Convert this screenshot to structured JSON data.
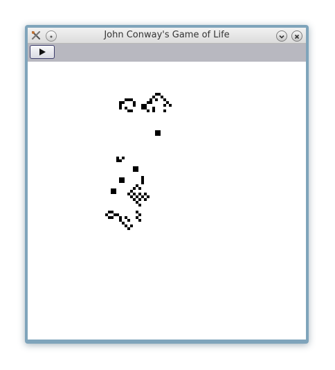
{
  "window": {
    "title": "John Conway's Game of Life",
    "frame_color": "#7fa4bb",
    "titlebar_color": "#e6e6e6"
  },
  "titlebar": {
    "app_icon": "tools-icon",
    "menu_button_icon": "circle-icon",
    "minimize_button_icon": "chevron-down-icon",
    "close_button_icon": "close-icon"
  },
  "toolbar": {
    "play_button_icon": "play-icon",
    "background": "#b8b8c0"
  },
  "board": {
    "background": "#ffffff",
    "cell_color": "#000000",
    "live_cell_count": 84
  }
}
